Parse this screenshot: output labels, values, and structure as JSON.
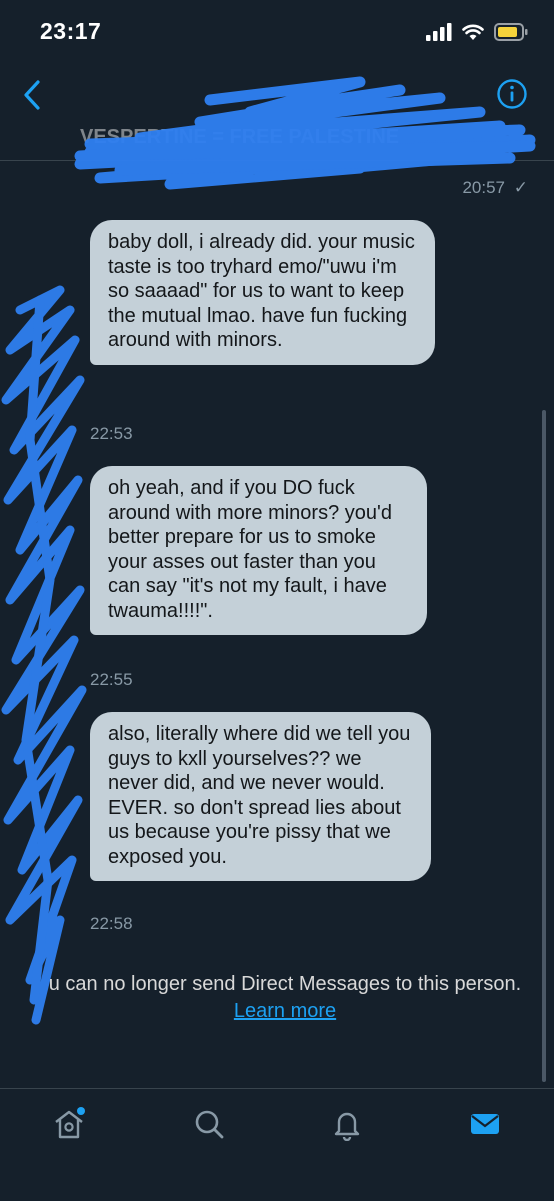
{
  "status_bar": {
    "time": "23:17",
    "icons": [
      "cellular-signal-icon",
      "wifi-icon",
      "battery-icon"
    ]
  },
  "header": {
    "back_icon": "chevron-left-icon",
    "info_icon": "info-icon",
    "conversation_name": "VESPERTINE = FREE PALESTINE"
  },
  "conversation": {
    "last_sent_time": "20:57",
    "sent_check": "✓",
    "messages": [
      {
        "text": "baby doll, i already did. your music taste is too tryhard emo/\"uwu i'm so saaaad\" for us to want to keep the mutual lmao. have fun fucking around with minors.",
        "time": "22:53"
      },
      {
        "text": "oh yeah, and if you DO fuck around with more minors? you'd better prepare for us to smoke your asses out faster than you can say \"it's not my fault, i have twauma!!!!\".",
        "time": "22:55"
      },
      {
        "text": "also, literally where did we tell you guys to kxll yourselves?? we never did, and we never would. EVER. so don't spread lies about us because you're pissy that we exposed you.",
        "time": "22:58"
      }
    ],
    "notice_text": "u can no longer send Direct Messages to this person.",
    "notice_link": "Learn more"
  },
  "tab_bar": {
    "tabs": [
      "home-icon",
      "search-icon",
      "notifications-icon",
      "messages-icon"
    ],
    "accent_color": "#1da1f2"
  },
  "colors": {
    "background": "#15202b",
    "bubble": "#c4d0d8",
    "muted": "#8899a6",
    "redaction": "#2f7ff0"
  }
}
